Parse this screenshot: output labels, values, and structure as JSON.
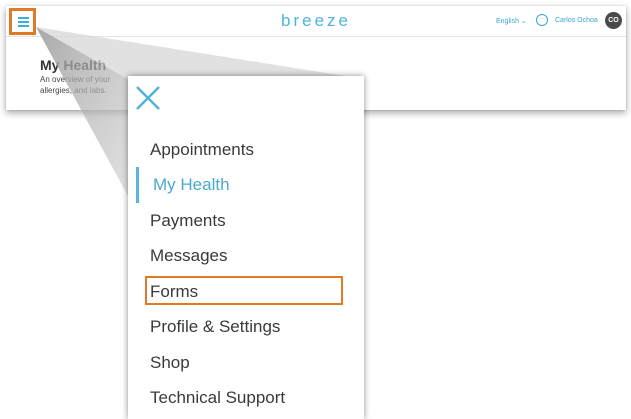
{
  "header": {
    "brand": "breeze",
    "language": "English ⌄",
    "user_name": "Carlos Ochoa",
    "avatar_initials": "CO",
    "chat_glyph": "···"
  },
  "page": {
    "title": "My Health",
    "description": "An overview of your allergies, and labs."
  },
  "menu": {
    "items": [
      {
        "label": "Appointments"
      },
      {
        "label": "My Health"
      },
      {
        "label": "Payments"
      },
      {
        "label": "Messages"
      },
      {
        "label": "Forms"
      },
      {
        "label": "Profile & Settings"
      },
      {
        "label": "Shop"
      },
      {
        "label": "Technical Support"
      }
    ],
    "active_item": "My Health",
    "highlighted_item": "Forms"
  },
  "icons": {
    "menu_toggle": "hamburger-icon",
    "close": "close-icon",
    "chat": "chat-icon"
  },
  "colors": {
    "accent": "#4fb4dc",
    "highlight": "#e07a24",
    "text": "#3a3a3a"
  }
}
